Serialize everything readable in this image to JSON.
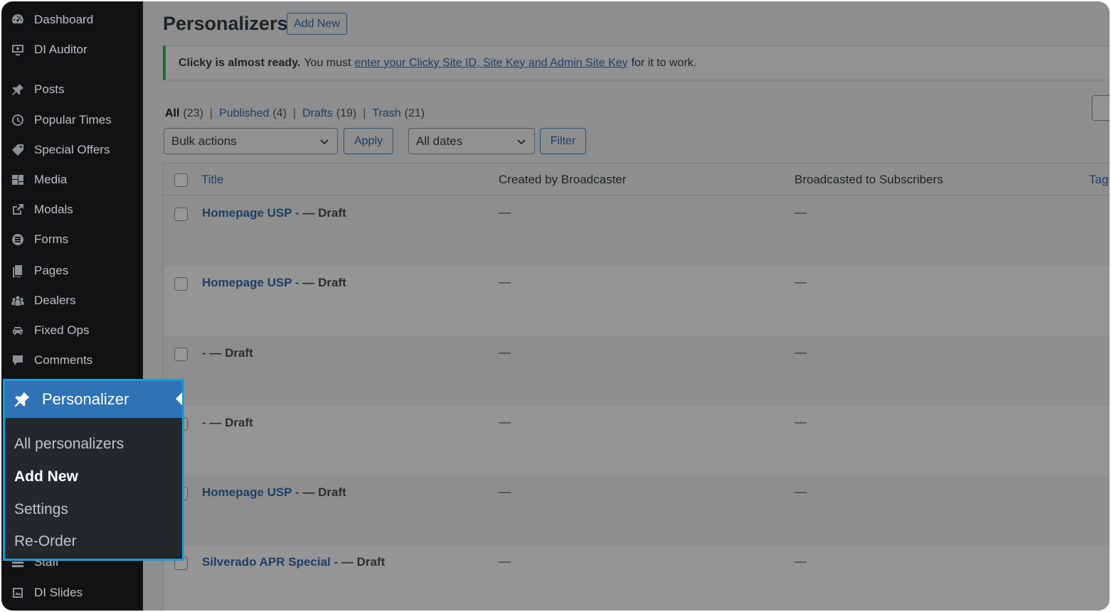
{
  "sidebar": {
    "items": [
      {
        "label": "Dashboard",
        "icon": "dashboard-icon"
      },
      {
        "label": "DI Auditor",
        "icon": "monitor-icon"
      },
      {
        "label": "Posts",
        "icon": "pushpin-icon"
      },
      {
        "label": "Popular Times",
        "icon": "clock-icon"
      },
      {
        "label": "Special Offers",
        "icon": "tag-icon"
      },
      {
        "label": "Media",
        "icon": "media-icon"
      },
      {
        "label": "Modals",
        "icon": "external-link-icon"
      },
      {
        "label": "Forms",
        "icon": "forms-icon"
      },
      {
        "label": "Pages",
        "icon": "pages-icon"
      },
      {
        "label": "Dealers",
        "icon": "groups-icon"
      },
      {
        "label": "Fixed Ops",
        "icon": "car-icon"
      },
      {
        "label": "Comments",
        "icon": "comment-icon"
      },
      {
        "label": "Staff",
        "icon": "staff-icon"
      },
      {
        "label": "DI Slides",
        "icon": "slides-icon"
      }
    ],
    "popup": {
      "label": "Personalizer",
      "icon": "pushpin-icon",
      "submenu": [
        "All personalizers",
        "Add New",
        "Settings",
        "Re-Order"
      ],
      "active": "Add New"
    }
  },
  "header": {
    "title": "Personalizers",
    "add_new": "Add New"
  },
  "notice": {
    "bold": "Clicky is almost ready.",
    "pre": "You must",
    "link": "enter your Clicky Site ID, Site Key and Admin Site Key",
    "post": "for it to work."
  },
  "views": {
    "all": "All",
    "all_count": "(23)",
    "published": "Published",
    "published_count": "(4)",
    "drafts": "Drafts",
    "drafts_count": "(19)",
    "trash": "Trash",
    "trash_count": "(21)",
    "sep": "|"
  },
  "filters": {
    "bulk_actions": "Bulk actions",
    "apply": "Apply",
    "all_dates": "All dates",
    "filter": "Filter"
  },
  "table": {
    "columns": [
      "Title",
      "Created by Broadcaster",
      "Broadcasted to Subscribers",
      "Tag"
    ],
    "rows": [
      {
        "title_link": "Homepage USP -",
        "state": " — Draft",
        "created": "—",
        "broadcasted": "—"
      },
      {
        "title_link": "Homepage USP -",
        "state": " — Draft",
        "created": "—",
        "broadcasted": "—"
      },
      {
        "title_link": "-",
        "state": " — Draft",
        "created": "—",
        "broadcasted": "—"
      },
      {
        "title_link": "-",
        "state": " — Draft",
        "created": "—",
        "broadcasted": "—"
      },
      {
        "title_link": "Homepage USP -",
        "state": " — Draft",
        "created": "—",
        "broadcasted": "—"
      },
      {
        "title_link": "Silverado APR Special -",
        "state": " — Draft",
        "created": "—",
        "broadcasted": "—"
      }
    ]
  },
  "colors": {
    "sidebar_bg": "#101214",
    "popup_header": "#2f73b5",
    "popup_border": "#1e9bd7",
    "link": "#1d3f66",
    "overlay_bg": "#8e8e8e"
  }
}
